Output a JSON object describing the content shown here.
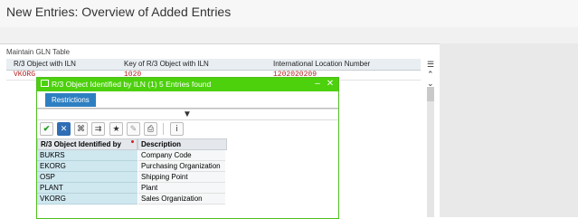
{
  "window": {
    "title": "New Entries: Overview of Added Entries"
  },
  "table": {
    "title": "Maintain GLN Table",
    "columns": [
      "R/3 Object with ILN",
      "Key of R/3 Object with ILN",
      "International Location Number"
    ],
    "row": [
      "VKORG",
      "1020",
      "1202020209"
    ]
  },
  "dialog": {
    "title": "R/3 Object Identified by ILN (1)",
    "count_text": "5 Entries found",
    "tab": "Restrictions",
    "grid": {
      "headers": [
        "R/3 Object Identified by",
        "Description"
      ],
      "rows": [
        [
          "BUKRS",
          "Company Code"
        ],
        [
          "EKORG",
          "Purchasing Organization"
        ],
        [
          "OSP",
          "Shipping Point"
        ],
        [
          "PLANT",
          "Plant"
        ],
        [
          "VKORG",
          "Sales Organization"
        ]
      ]
    }
  },
  "colors": {
    "dialog_header": "#4cd10c",
    "tab": "#2d7fc1",
    "key_cell": "#cfe7ef",
    "value_text": "#b42222"
  }
}
